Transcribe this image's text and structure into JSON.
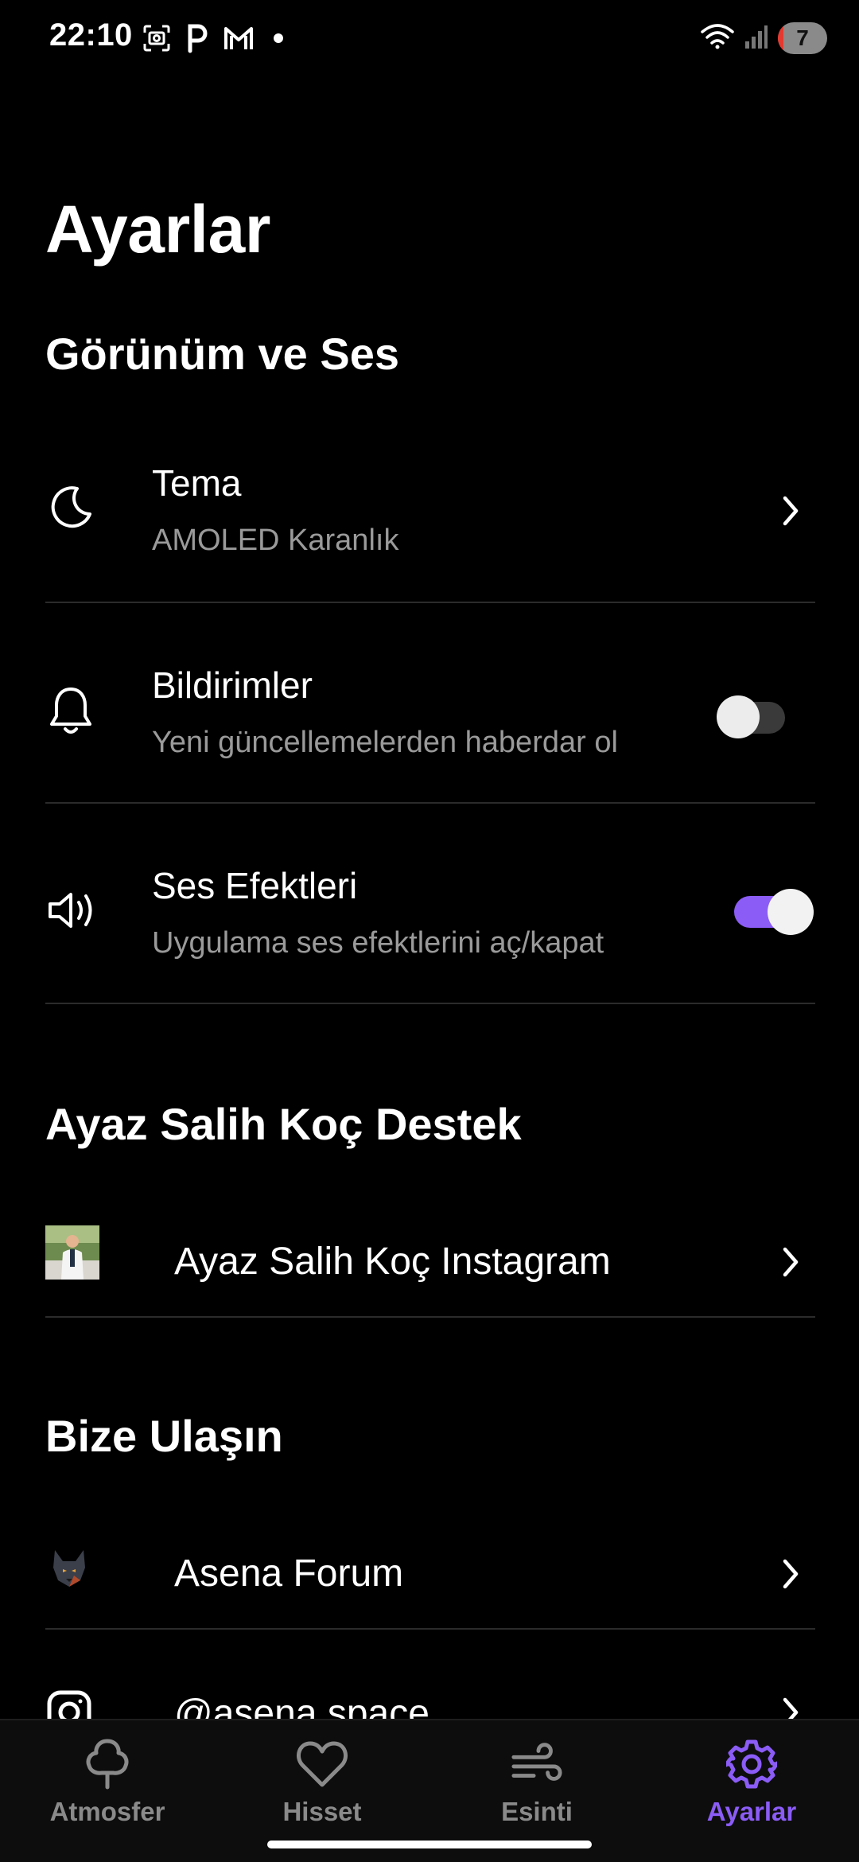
{
  "status_bar": {
    "time": "22:10",
    "left_icons": [
      "screenshot-icon",
      "parking-icon",
      "gmail-icon",
      "dot-icon"
    ],
    "right_icons": [
      "wifi-icon",
      "signal-icon"
    ],
    "battery_level": "7",
    "battery_fraction": 0.07,
    "battery_low_color": "#e5392f"
  },
  "page": {
    "title": "Ayarlar"
  },
  "sections": {
    "appearance": {
      "title": "Görünüm ve Ses",
      "theme": {
        "icon": "moon-icon",
        "title": "Tema",
        "subtitle": "AMOLED Karanlık"
      },
      "notifications": {
        "icon": "bell-icon",
        "title": "Bildirimler",
        "subtitle": "Yeni güncellemelerden haberdar ol",
        "enabled": false
      },
      "sound": {
        "icon": "speaker-icon",
        "title": "Ses Efektleri",
        "subtitle": "Uygulama ses efektlerini aç/kapat",
        "enabled": true
      }
    },
    "support": {
      "title": "Ayaz Salih Koç Destek",
      "instagram": {
        "icon": "profile-photo",
        "title": "Ayaz Salih Koç Instagram"
      }
    },
    "contact": {
      "title": "Bize Ulaşın",
      "forum": {
        "icon": "wolf-logo",
        "title": "Asena Forum"
      },
      "instagram": {
        "icon": "instagram-icon",
        "title": "@asena.space"
      }
    }
  },
  "bottom_nav": {
    "items": [
      {
        "label": "Atmosfer",
        "icon": "tree-icon",
        "active": false
      },
      {
        "label": "Hisset",
        "icon": "heart-icon",
        "active": false
      },
      {
        "label": "Esinti",
        "icon": "wind-icon",
        "active": false
      },
      {
        "label": "Ayarlar",
        "icon": "gear-icon",
        "active": true
      }
    ]
  },
  "colors": {
    "background": "#000000",
    "accent": "#8b5cf6",
    "divider": "#2b2b2b",
    "subtitle": "#9a9a9a",
    "nav_inactive": "#8a8a8a"
  }
}
